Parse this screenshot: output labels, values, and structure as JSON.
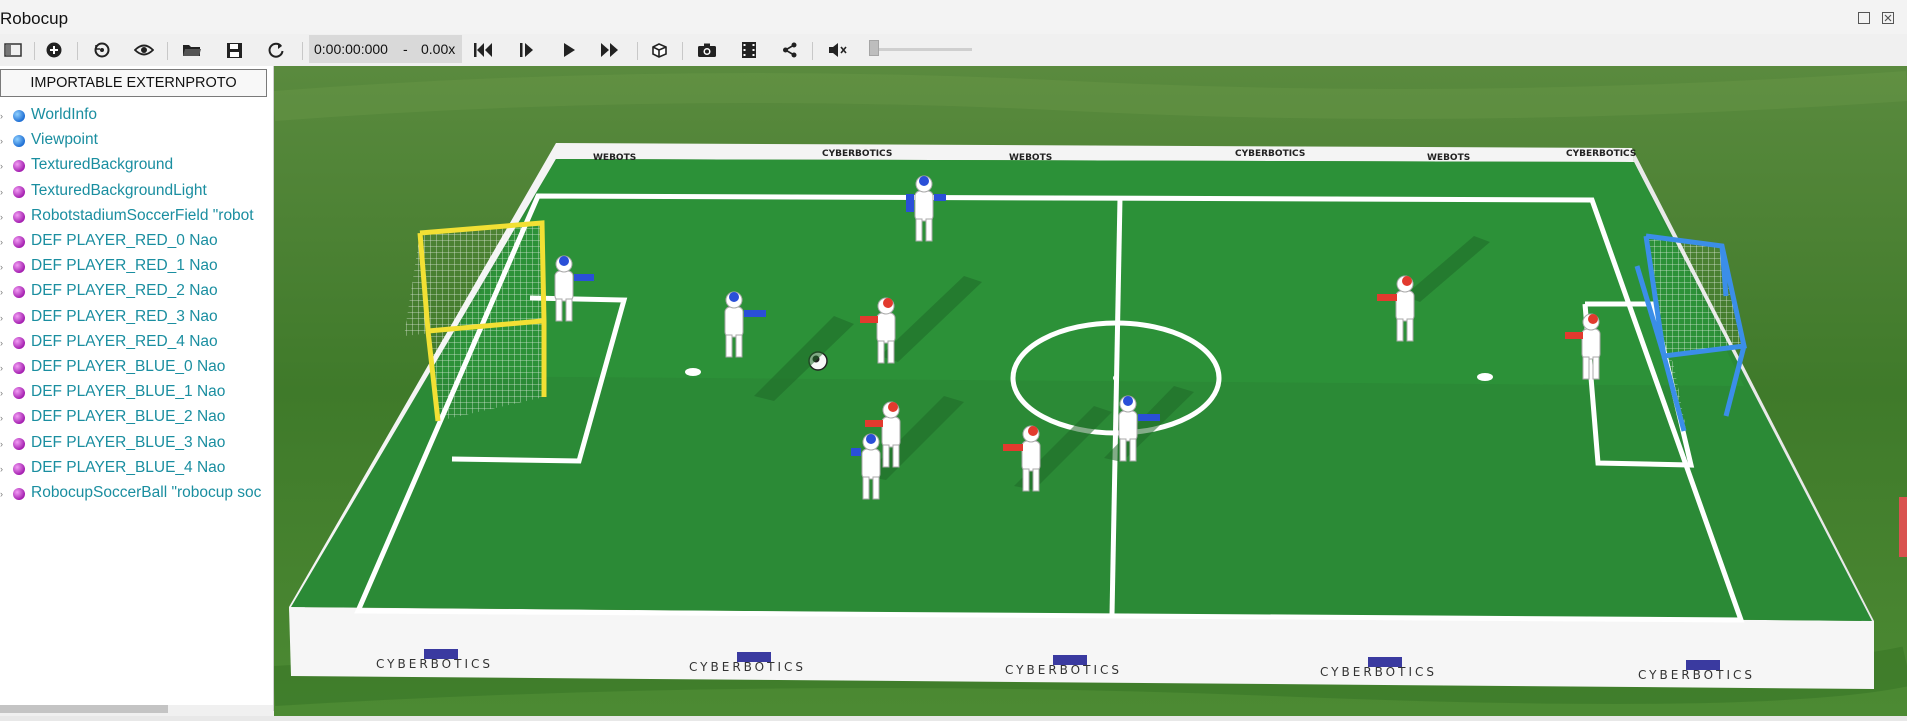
{
  "window": {
    "title": "Robocup"
  },
  "toolbar": {
    "time": "0:00:00:000",
    "dash": "-",
    "speed": "0.00x",
    "buttons": [
      {
        "name": "toggle-scene-tree",
        "icon": "panel-icon"
      },
      {
        "name": "add-node",
        "icon": "plus-circle-icon"
      },
      {
        "name": "reset-view",
        "icon": "reset-icon"
      },
      {
        "name": "visibility",
        "icon": "eye-icon"
      },
      {
        "name": "open-world",
        "icon": "folder-icon"
      },
      {
        "name": "save-world",
        "icon": "save-icon"
      },
      {
        "name": "reload-world",
        "icon": "reload-icon"
      },
      {
        "name": "reset-simulation",
        "icon": "skip-back-icon"
      },
      {
        "name": "step",
        "icon": "step-icon"
      },
      {
        "name": "run-realtime",
        "icon": "play-icon"
      },
      {
        "name": "fast-forward",
        "icon": "fast-forward-icon"
      },
      {
        "name": "view-3d",
        "icon": "cube-icon"
      },
      {
        "name": "take-screenshot",
        "icon": "camera-icon"
      },
      {
        "name": "record-movie",
        "icon": "film-icon"
      },
      {
        "name": "share",
        "icon": "share-icon"
      },
      {
        "name": "mute",
        "icon": "speaker-mute-icon"
      }
    ]
  },
  "sidebar": {
    "proto_button": "IMPORTABLE EXTERNPROTO",
    "nodes": [
      {
        "label": "WorldInfo",
        "color": "blue"
      },
      {
        "label": "Viewpoint",
        "color": "blue"
      },
      {
        "label": "TexturedBackground",
        "color": "purple"
      },
      {
        "label": "TexturedBackgroundLight",
        "color": "purple"
      },
      {
        "label": "RobotstadiumSoccerField \"robot",
        "color": "purple"
      },
      {
        "label": "DEF PLAYER_RED_0 Nao",
        "color": "purple"
      },
      {
        "label": "DEF PLAYER_RED_1 Nao",
        "color": "purple"
      },
      {
        "label": "DEF PLAYER_RED_2 Nao",
        "color": "purple"
      },
      {
        "label": "DEF PLAYER_RED_3 Nao",
        "color": "purple"
      },
      {
        "label": "DEF PLAYER_RED_4 Nao",
        "color": "purple"
      },
      {
        "label": "DEF PLAYER_BLUE_0 Nao",
        "color": "purple"
      },
      {
        "label": "DEF PLAYER_BLUE_1 Nao",
        "color": "purple"
      },
      {
        "label": "DEF PLAYER_BLUE_2 Nao",
        "color": "purple"
      },
      {
        "label": "DEF PLAYER_BLUE_3 Nao",
        "color": "purple"
      },
      {
        "label": "DEF PLAYER_BLUE_4 Nao",
        "color": "purple"
      },
      {
        "label": "RobocupSoccerBall \"robocup soc",
        "color": "purple"
      }
    ]
  },
  "viewport": {
    "banner_top": "WEBOTS",
    "banner_bottom": "CYBERBOTICS",
    "colors": {
      "grass": "#2f8a32",
      "field": "#2a8a35",
      "wall": "#f5f5f5",
      "goal_left": "#f2e034",
      "goal_right": "#3b8ee8",
      "team_red": "#e23a2e",
      "team_blue": "#2a4fd8"
    }
  }
}
